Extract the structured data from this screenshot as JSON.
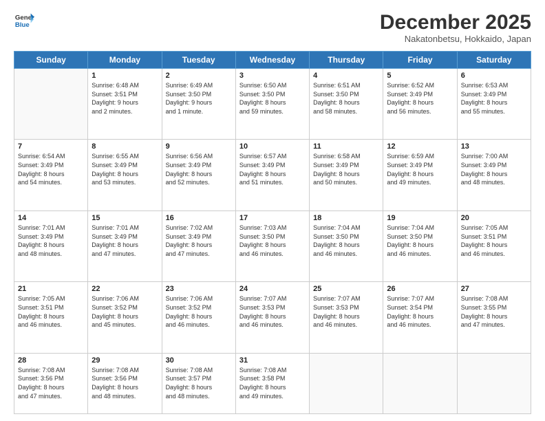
{
  "header": {
    "logo_line1": "General",
    "logo_line2": "Blue",
    "month": "December 2025",
    "location": "Nakatonbetsu, Hokkaido, Japan"
  },
  "weekdays": [
    "Sunday",
    "Monday",
    "Tuesday",
    "Wednesday",
    "Thursday",
    "Friday",
    "Saturday"
  ],
  "weeks": [
    [
      {
        "day": "",
        "sunrise": "",
        "sunset": "",
        "daylight": ""
      },
      {
        "day": "1",
        "sunrise": "6:48 AM",
        "sunset": "3:51 PM",
        "daylight": "9 hours and 2 minutes."
      },
      {
        "day": "2",
        "sunrise": "6:49 AM",
        "sunset": "3:50 PM",
        "daylight": "9 hours and 1 minute."
      },
      {
        "day": "3",
        "sunrise": "6:50 AM",
        "sunset": "3:50 PM",
        "daylight": "8 hours and 59 minutes."
      },
      {
        "day": "4",
        "sunrise": "6:51 AM",
        "sunset": "3:50 PM",
        "daylight": "8 hours and 58 minutes."
      },
      {
        "day": "5",
        "sunrise": "6:52 AM",
        "sunset": "3:49 PM",
        "daylight": "8 hours and 56 minutes."
      },
      {
        "day": "6",
        "sunrise": "6:53 AM",
        "sunset": "3:49 PM",
        "daylight": "8 hours and 55 minutes."
      }
    ],
    [
      {
        "day": "7",
        "sunrise": "6:54 AM",
        "sunset": "3:49 PM",
        "daylight": "8 hours and 54 minutes."
      },
      {
        "day": "8",
        "sunrise": "6:55 AM",
        "sunset": "3:49 PM",
        "daylight": "8 hours and 53 minutes."
      },
      {
        "day": "9",
        "sunrise": "6:56 AM",
        "sunset": "3:49 PM",
        "daylight": "8 hours and 52 minutes."
      },
      {
        "day": "10",
        "sunrise": "6:57 AM",
        "sunset": "3:49 PM",
        "daylight": "8 hours and 51 minutes."
      },
      {
        "day": "11",
        "sunrise": "6:58 AM",
        "sunset": "3:49 PM",
        "daylight": "8 hours and 50 minutes."
      },
      {
        "day": "12",
        "sunrise": "6:59 AM",
        "sunset": "3:49 PM",
        "daylight": "8 hours and 49 minutes."
      },
      {
        "day": "13",
        "sunrise": "7:00 AM",
        "sunset": "3:49 PM",
        "daylight": "8 hours and 48 minutes."
      }
    ],
    [
      {
        "day": "14",
        "sunrise": "7:01 AM",
        "sunset": "3:49 PM",
        "daylight": "8 hours and 48 minutes."
      },
      {
        "day": "15",
        "sunrise": "7:01 AM",
        "sunset": "3:49 PM",
        "daylight": "8 hours and 47 minutes."
      },
      {
        "day": "16",
        "sunrise": "7:02 AM",
        "sunset": "3:49 PM",
        "daylight": "8 hours and 47 minutes."
      },
      {
        "day": "17",
        "sunrise": "7:03 AM",
        "sunset": "3:50 PM",
        "daylight": "8 hours and 46 minutes."
      },
      {
        "day": "18",
        "sunrise": "7:04 AM",
        "sunset": "3:50 PM",
        "daylight": "8 hours and 46 minutes."
      },
      {
        "day": "19",
        "sunrise": "7:04 AM",
        "sunset": "3:50 PM",
        "daylight": "8 hours and 46 minutes."
      },
      {
        "day": "20",
        "sunrise": "7:05 AM",
        "sunset": "3:51 PM",
        "daylight": "8 hours and 46 minutes."
      }
    ],
    [
      {
        "day": "21",
        "sunrise": "7:05 AM",
        "sunset": "3:51 PM",
        "daylight": "8 hours and 46 minutes."
      },
      {
        "day": "22",
        "sunrise": "7:06 AM",
        "sunset": "3:52 PM",
        "daylight": "8 hours and 45 minutes."
      },
      {
        "day": "23",
        "sunrise": "7:06 AM",
        "sunset": "3:52 PM",
        "daylight": "8 hours and 46 minutes."
      },
      {
        "day": "24",
        "sunrise": "7:07 AM",
        "sunset": "3:53 PM",
        "daylight": "8 hours and 46 minutes."
      },
      {
        "day": "25",
        "sunrise": "7:07 AM",
        "sunset": "3:53 PM",
        "daylight": "8 hours and 46 minutes."
      },
      {
        "day": "26",
        "sunrise": "7:07 AM",
        "sunset": "3:54 PM",
        "daylight": "8 hours and 46 minutes."
      },
      {
        "day": "27",
        "sunrise": "7:08 AM",
        "sunset": "3:55 PM",
        "daylight": "8 hours and 47 minutes."
      }
    ],
    [
      {
        "day": "28",
        "sunrise": "7:08 AM",
        "sunset": "3:56 PM",
        "daylight": "8 hours and 47 minutes."
      },
      {
        "day": "29",
        "sunrise": "7:08 AM",
        "sunset": "3:56 PM",
        "daylight": "8 hours and 48 minutes."
      },
      {
        "day": "30",
        "sunrise": "7:08 AM",
        "sunset": "3:57 PM",
        "daylight": "8 hours and 48 minutes."
      },
      {
        "day": "31",
        "sunrise": "7:08 AM",
        "sunset": "3:58 PM",
        "daylight": "8 hours and 49 minutes."
      },
      {
        "day": "",
        "sunrise": "",
        "sunset": "",
        "daylight": ""
      },
      {
        "day": "",
        "sunrise": "",
        "sunset": "",
        "daylight": ""
      },
      {
        "day": "",
        "sunrise": "",
        "sunset": "",
        "daylight": ""
      }
    ]
  ]
}
